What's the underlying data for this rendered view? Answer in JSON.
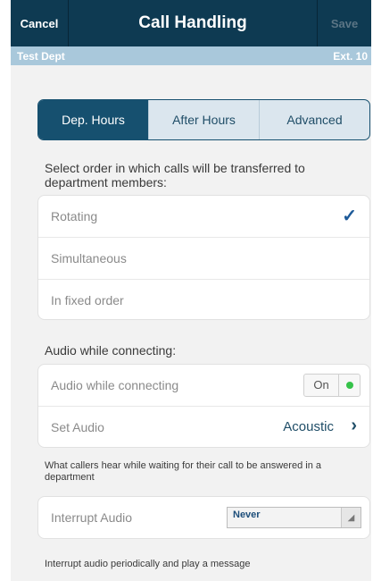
{
  "nav": {
    "cancel_label": "Cancel",
    "title": "Call Handling",
    "save_label": "Save"
  },
  "subheader": {
    "department": "Test Dept",
    "extension": "Ext. 10"
  },
  "tabs": [
    {
      "label": "Dep. Hours",
      "active": true
    },
    {
      "label": "After Hours",
      "active": false
    },
    {
      "label": "Advanced",
      "active": false
    }
  ],
  "order_section": {
    "prompt": "Select order in which calls will be transferred to department members:",
    "options": [
      {
        "label": "Rotating",
        "selected": true
      },
      {
        "label": "Simultaneous",
        "selected": false
      },
      {
        "label": "In fixed order",
        "selected": false
      }
    ]
  },
  "audio_section": {
    "header": "Audio while connecting:",
    "toggle_row_label": "Audio while connecting",
    "toggle_state": "On",
    "set_audio_label": "Set Audio",
    "set_audio_value": "Acoustic",
    "description": "What callers hear while waiting for their call to be answered in a department"
  },
  "interrupt_section": {
    "label": "Interrupt Audio",
    "value": "Never",
    "description": "Interrupt audio periodically and play a message"
  },
  "icons": {
    "check": "checkmark-icon",
    "chevron": "chevron-right-icon",
    "dropdown": "dropdown-arrow-icon",
    "toggle_on": "status-dot-icon"
  },
  "colors": {
    "navbar": "#0e3a52",
    "subheader": "#a9c8db",
    "accent": "#16506f",
    "toggle_on": "#36c24a"
  }
}
